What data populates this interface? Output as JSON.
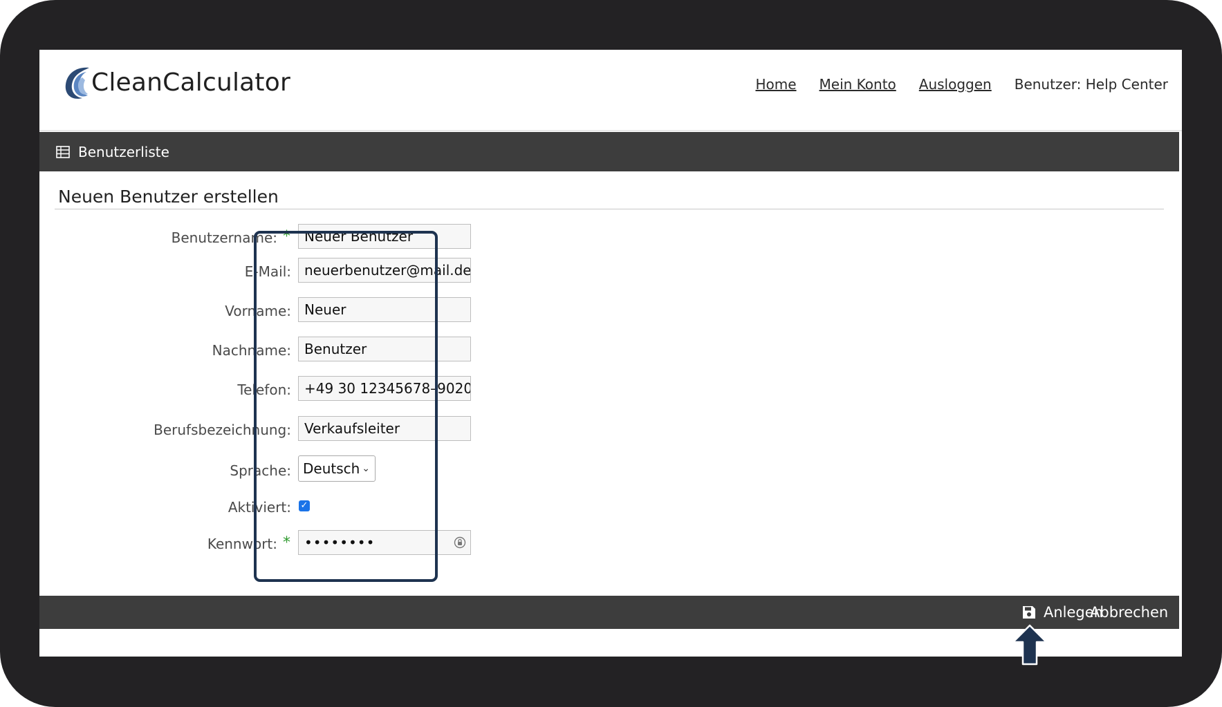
{
  "app": {
    "name": "CleanCalculator"
  },
  "nav": {
    "items": [
      {
        "label": "Home"
      },
      {
        "label": "Mein Konto"
      },
      {
        "label": "Ausloggen"
      }
    ],
    "user_label": "Benutzer: Help Center"
  },
  "toolbar": {
    "user_list_label": "Benutzerliste",
    "icon": "table-icon"
  },
  "page": {
    "title": "Neuen Benutzer erstellen"
  },
  "form": {
    "fields": [
      {
        "label": "Benutzername:",
        "value": "Neuer Benutzer",
        "required": true
      },
      {
        "label": "E-Mail:",
        "value": "neuerbenutzer@mail.de",
        "required": false
      },
      {
        "label": "Vorname:",
        "value": "Neuer",
        "required": false
      },
      {
        "label": "Nachname:",
        "value": "Benutzer",
        "required": false
      },
      {
        "label": "Telefon:",
        "value": "+49 30 12345678–9020",
        "required": false
      },
      {
        "label": "Berufsbezeichnung:",
        "value": "Verkaufsleiter",
        "required": false
      }
    ],
    "language": {
      "label": "Sprache:",
      "value": "Deutsch"
    },
    "activated": {
      "label": "Aktiviert:",
      "checked": true
    },
    "password": {
      "label": "Kennwort:",
      "value": "••••••••",
      "required": true
    },
    "required_marker": "*"
  },
  "actions": {
    "save_label": "Anlegen",
    "cancel_label": "Abbrechen",
    "save_icon": "floppy-disk-icon"
  },
  "colors": {
    "bar": "#3d3d3d",
    "highlight": "#1e3350",
    "required": "#2e9a2e",
    "bezel": "#232224"
  }
}
